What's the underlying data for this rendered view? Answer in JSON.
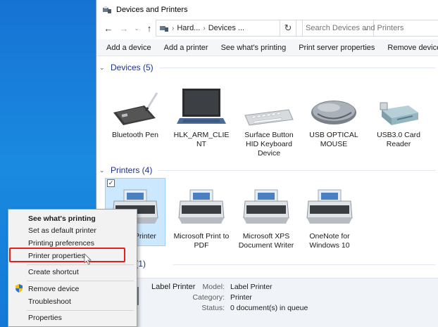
{
  "window": {
    "title": "Devices and Printers",
    "address": {
      "seg1": "Hard...",
      "seg2": "Devices ..."
    },
    "search_placeholder": "Search Devices and Printers"
  },
  "toolbar": {
    "add_device": "Add a device",
    "add_printer": "Add a printer",
    "see_printing": "See what's printing",
    "print_server": "Print server properties",
    "remove_device": "Remove device"
  },
  "groups": {
    "devices": "Devices (5)",
    "printers": "Printers (4)",
    "unspecified_partial": "ified (1)"
  },
  "devices": [
    {
      "label": "Bluetooth Pen",
      "icon": "pen-tablet-icon"
    },
    {
      "label": "HLK_ARM_CLIENT",
      "icon": "laptop-icon"
    },
    {
      "label": "Surface Button HID Keyboard Device",
      "icon": "keyboard-icon"
    },
    {
      "label": "USB OPTICAL MOUSE",
      "icon": "mouse-icon"
    },
    {
      "label": "USB3.0 Card Reader",
      "icon": "card-reader-icon"
    }
  ],
  "printers": [
    {
      "label": "Printer",
      "icon": "printer-icon"
    },
    {
      "label": "Microsoft Print to PDF",
      "icon": "printer-icon"
    },
    {
      "label": "Microsoft XPS Document Writer",
      "icon": "printer-icon"
    },
    {
      "label": "OneNote for Windows 10",
      "icon": "printer-icon"
    }
  ],
  "details": {
    "name": "Label Printer",
    "model_key": "Model:",
    "model_val": "Label Printer",
    "category_key": "Category:",
    "category_val": "Printer",
    "status_key": "Status:",
    "status_val": "0 document(s) in queue"
  },
  "context_menu": {
    "see_printing": "See what's printing",
    "set_default": "Set as default printer",
    "preferences": "Printing preferences",
    "properties": "Printer properties",
    "shortcut": "Create shortcut",
    "remove": "Remove device",
    "troubleshoot": "Troubleshoot",
    "props": "Properties"
  },
  "colors": {
    "desktop": "#1673d3",
    "group_header": "#1e3287",
    "selection": "#cce8ff",
    "highlight_box": "#e02020"
  }
}
